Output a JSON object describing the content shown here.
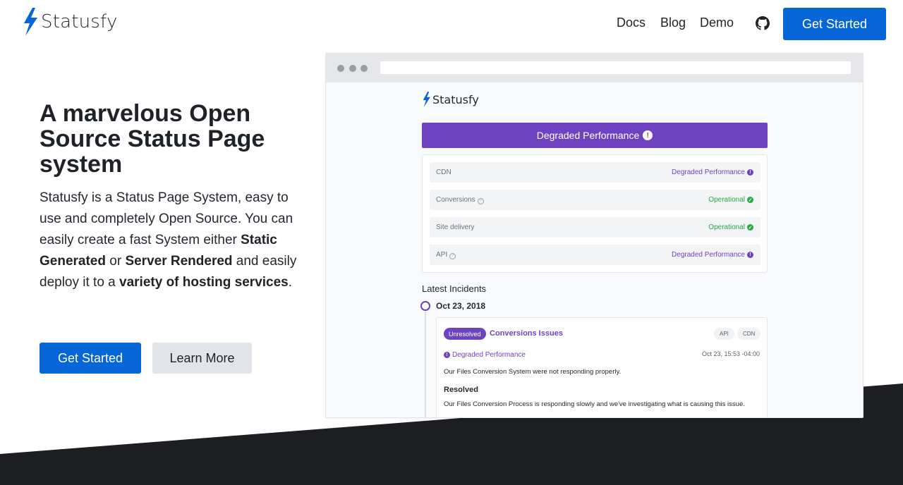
{
  "colors": {
    "primary": "#0766d7",
    "accent_purple": "#6f42c1",
    "operational_green": "#28a745",
    "dark_band": "#1c1e22"
  },
  "nav": {
    "brand": "Statusfy",
    "links": [
      "Docs",
      "Blog",
      "Demo"
    ],
    "github_icon": "github-icon",
    "cta_label": "Get Started"
  },
  "hero": {
    "title": "A marvelous Open Source Status Page system",
    "desc_parts": [
      "Statusfy is a Status Page System, easy to use and completely Open Source. You can easily create a fast System either ",
      "Static Generated",
      " or ",
      "Server Rendered",
      " and easily deploy it to a ",
      "variety of hosting services",
      "."
    ],
    "primary_button": "Get Started",
    "secondary_button": "Learn More"
  },
  "mockup": {
    "brand": "Statusfy",
    "banner": "Degraded Performance",
    "services": [
      {
        "name": "CDN",
        "status": "Degraded Performance",
        "kind": "degraded",
        "help": false
      },
      {
        "name": "Conversions",
        "status": "Operational",
        "kind": "ok",
        "help": true
      },
      {
        "name": "Site delivery",
        "status": "Operational",
        "kind": "ok",
        "help": false
      },
      {
        "name": "API",
        "status": "Degraded Performance",
        "kind": "degraded",
        "help": true
      }
    ],
    "latest_heading": "Latest Incidents",
    "incident_date": "Oct 23, 2018",
    "incident": {
      "badge": "Unresolved",
      "title": "Conversions Issues",
      "tags": [
        "API",
        "CDN"
      ],
      "status": "Degraded Performance",
      "time": "Oct 23, 15:53 -04:00",
      "message": "Our Files Conversion System were not responding properly.",
      "update_heading": "Resolved",
      "update_message": "Our Files Conversion Process is responding slowly and we've investigating what is causing this issue."
    }
  }
}
